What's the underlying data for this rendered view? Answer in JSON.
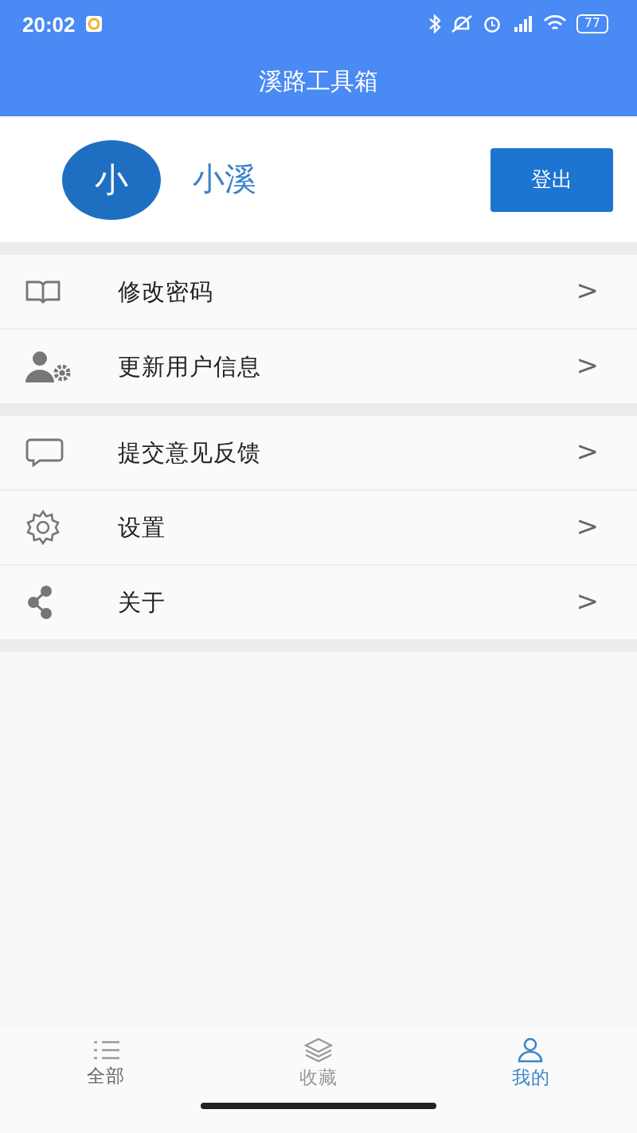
{
  "status_bar": {
    "time": "20:02",
    "battery": "77"
  },
  "app_bar": {
    "title": "溪路工具箱"
  },
  "profile": {
    "avatar": "小",
    "name": "小溪",
    "logout": "登出"
  },
  "menu_groups": [
    [
      {
        "label": "修改密码",
        "chevron": ">"
      },
      {
        "label": "更新用户信息",
        "chevron": ">"
      }
    ],
    [
      {
        "label": "提交意见反馈",
        "chevron": ">"
      },
      {
        "label": "设置",
        "chevron": ">"
      },
      {
        "label": "关于",
        "chevron": ">"
      }
    ]
  ],
  "tabs": [
    {
      "label": "全部",
      "selected": false
    },
    {
      "label": "收藏",
      "selected": false
    },
    {
      "label": "我的",
      "selected": true
    }
  ]
}
